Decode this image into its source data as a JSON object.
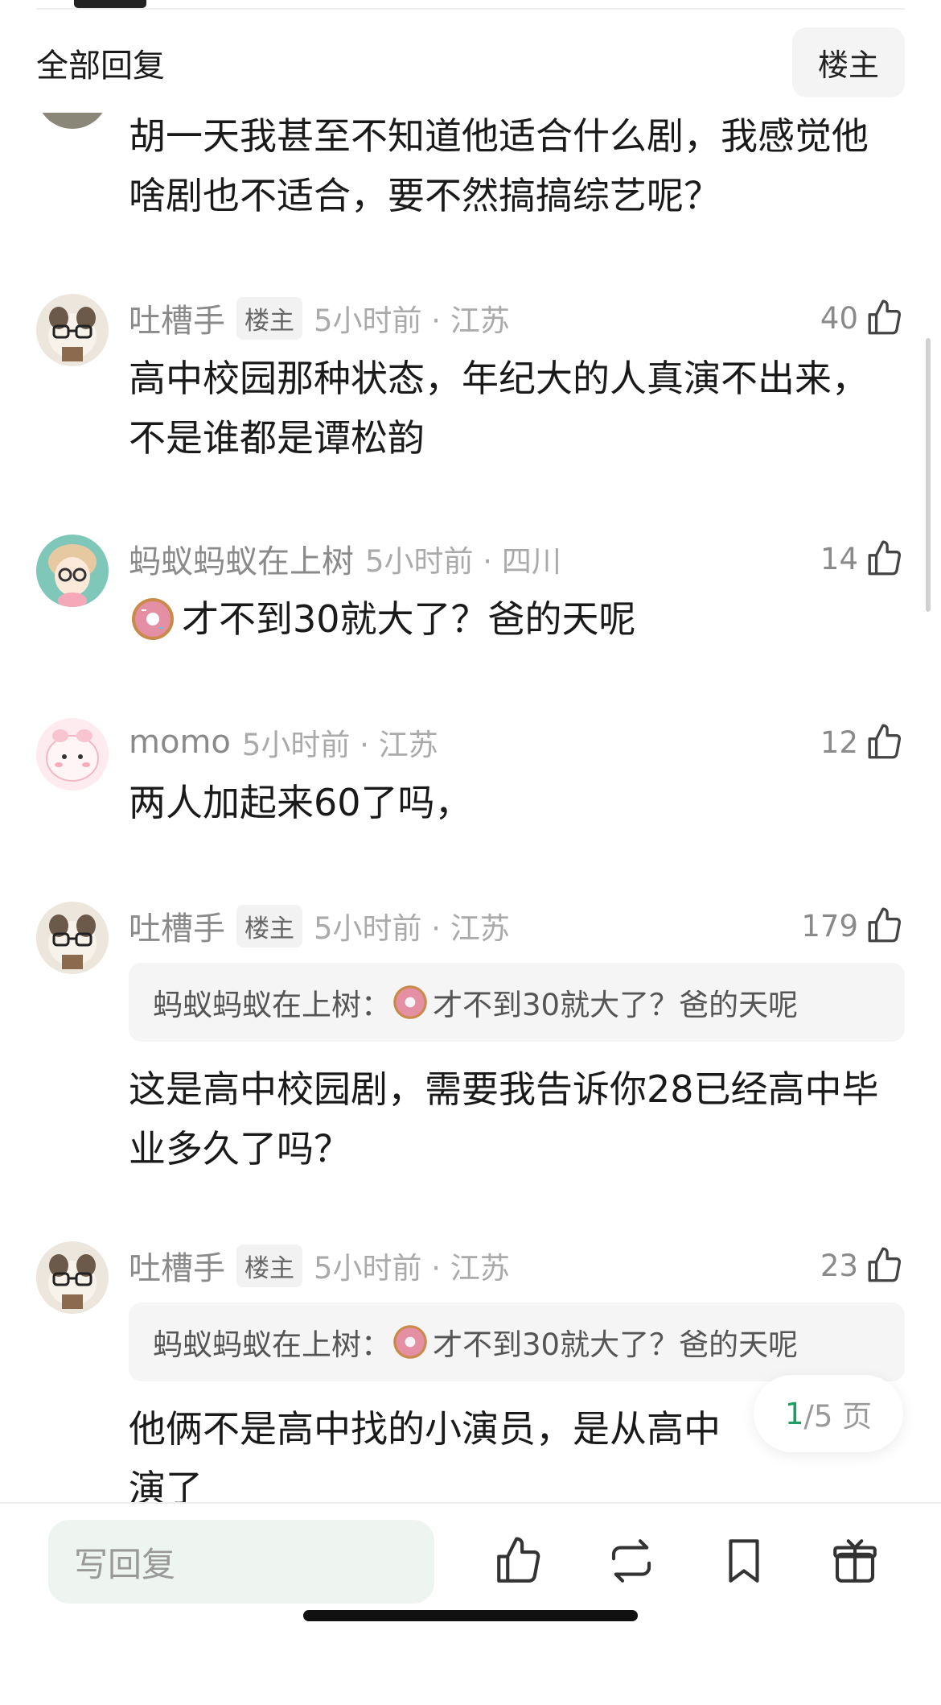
{
  "header": {
    "title": "全部回复",
    "louzhu_filter": "楼主"
  },
  "comments": [
    {
      "text": "胡一天我甚至不知道他适合什么剧，我感觉他啥剧也不适合，要不然搞搞综艺呢？"
    },
    {
      "username": "吐槽手",
      "badge": "楼主",
      "time_loc": "5小时前 · 江苏",
      "likes": "40",
      "text": "高中校园那种状态，年纪大的人真演不出来，不是谁都是谭松韵"
    },
    {
      "username": "蚂蚁蚂蚁在上树",
      "time_loc": "5小时前 · 四川",
      "likes": "14",
      "text": "才不到30就大了？爸的天呢"
    },
    {
      "username": "momo",
      "time_loc": "5小时前 · 江苏",
      "likes": "12",
      "text": "两人加起来60了吗，"
    },
    {
      "username": "吐槽手",
      "badge": "楼主",
      "time_loc": "5小时前 · 江苏",
      "likes": "179",
      "quote_user": "蚂蚁蚂蚁在上树：",
      "quote_text": "才不到30就大了？爸的天呢",
      "text": "这是高中校园剧，需要我告诉你28已经高中毕业多久了吗？"
    },
    {
      "username": "吐槽手",
      "badge": "楼主",
      "time_loc": "5小时前 · 江苏",
      "likes": "23",
      "quote_user": "蚂蚁蚂蚁在上树：",
      "quote_text": "才不到30就大了？爸的天呢",
      "text": "他俩不是高中找的小演员，是从高中",
      "text2": "演了"
    }
  ],
  "pager": {
    "current": "1",
    "total": "/5 页"
  },
  "bottom_bar": {
    "reply_placeholder": "写回复"
  },
  "icons": [
    "thumb-up-icon",
    "repost-icon",
    "bookmark-icon",
    "gift-icon",
    "donut-emoji"
  ],
  "colors": {
    "accent": "#1e9e63",
    "meta": "#aaaaaa",
    "input_bg": "#eef4f0"
  }
}
